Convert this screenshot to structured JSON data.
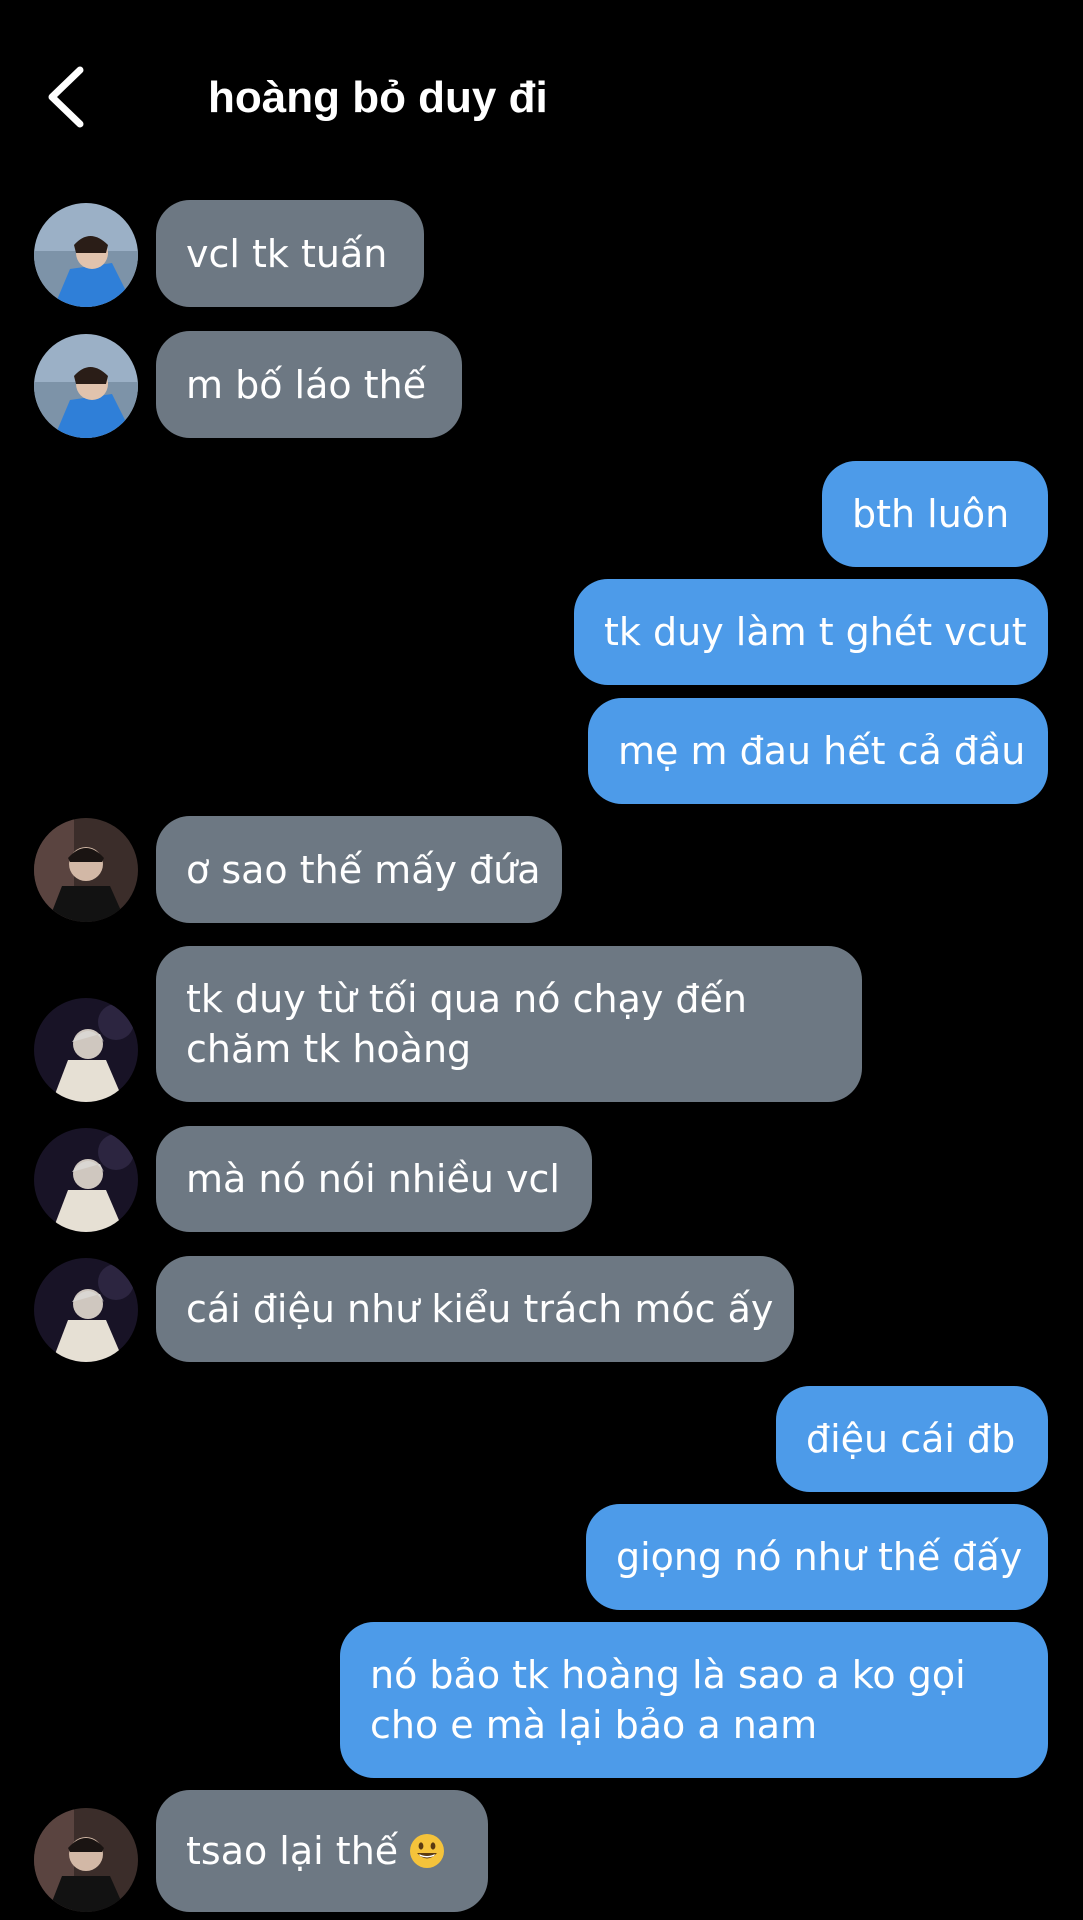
{
  "header": {
    "title": "hoàng bỏ duy đi",
    "back_icon": "chevron-left-icon"
  },
  "messages": [
    {
      "side": "in",
      "text": "vcl tk tuấn",
      "avatar": "avatar-tuan"
    },
    {
      "side": "in",
      "text": "m bố láo thế",
      "avatar": "avatar-tuan"
    },
    {
      "side": "out",
      "text": "bth luôn"
    },
    {
      "side": "out",
      "text": "tk duy làm t ghét vcut"
    },
    {
      "side": "out",
      "text": "mẹ m đau hết cả đầu"
    },
    {
      "side": "in",
      "text": "ơ sao thế mấy đứa",
      "avatar": "avatar-dark"
    },
    {
      "side": "in",
      "text": "tk duy từ tối qua nó chạy đến chăm tk hoàng",
      "avatar": "avatar-white"
    },
    {
      "side": "in",
      "text": "mà nó nói nhiều vcl",
      "avatar": "avatar-white"
    },
    {
      "side": "in",
      "text": "cái điệu như kiểu trách móc ấy",
      "avatar": "avatar-white"
    },
    {
      "side": "out",
      "text": "điệu cái đb"
    },
    {
      "side": "out",
      "text": "giọng nó như thế đấy"
    },
    {
      "side": "out",
      "text": "nó bảo tk hoàng là sao a ko gọi cho e mà lại bảo a nam"
    },
    {
      "side": "in",
      "text": "tsao lại thế",
      "avatar": "avatar-dark",
      "emoji": "grinning-face-icon"
    }
  ],
  "colors": {
    "background": "#000000",
    "incoming_bubble": "#6d7883",
    "outgoing_bubble": "#4d9be9",
    "text": "#ffffff"
  }
}
